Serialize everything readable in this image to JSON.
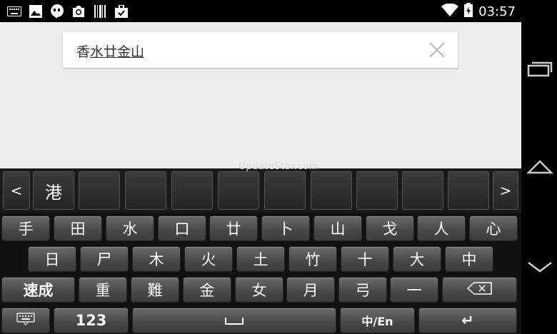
{
  "status": {
    "time": "03:57",
    "left_icons": [
      "keyboard-icon",
      "image-icon",
      "hangouts-icon",
      "camera-icon",
      "barcode-icon",
      "briefcase-icon"
    ],
    "right_icons": [
      "wifi-icon",
      "battery-icon"
    ]
  },
  "search": {
    "prefix": "香",
    "composing": "水廿金山"
  },
  "watermark": "UpdateStar.com",
  "candidates": {
    "prev": "<",
    "next": ">",
    "items": [
      "港",
      "",
      "",
      "",
      "",
      "",
      "",
      "",
      "",
      ""
    ]
  },
  "rows": {
    "row1": [
      "手",
      "田",
      "水",
      "口",
      "廿",
      "卜",
      "山",
      "戈",
      "人",
      "心"
    ],
    "row2": [
      "日",
      "尸",
      "木",
      "火",
      "土",
      "竹",
      "十",
      "大",
      "中"
    ],
    "row3": [
      "速成",
      "重",
      "難",
      "金",
      "女",
      "月",
      "弓",
      "一"
    ],
    "row4": {
      "num": "123",
      "space": "␣",
      "lang": "中/En",
      "enter": "↵"
    }
  },
  "colors": {
    "content_bg": "#ececec",
    "keyboard_bg": "#111111",
    "key_top": "#6a6a6a"
  }
}
